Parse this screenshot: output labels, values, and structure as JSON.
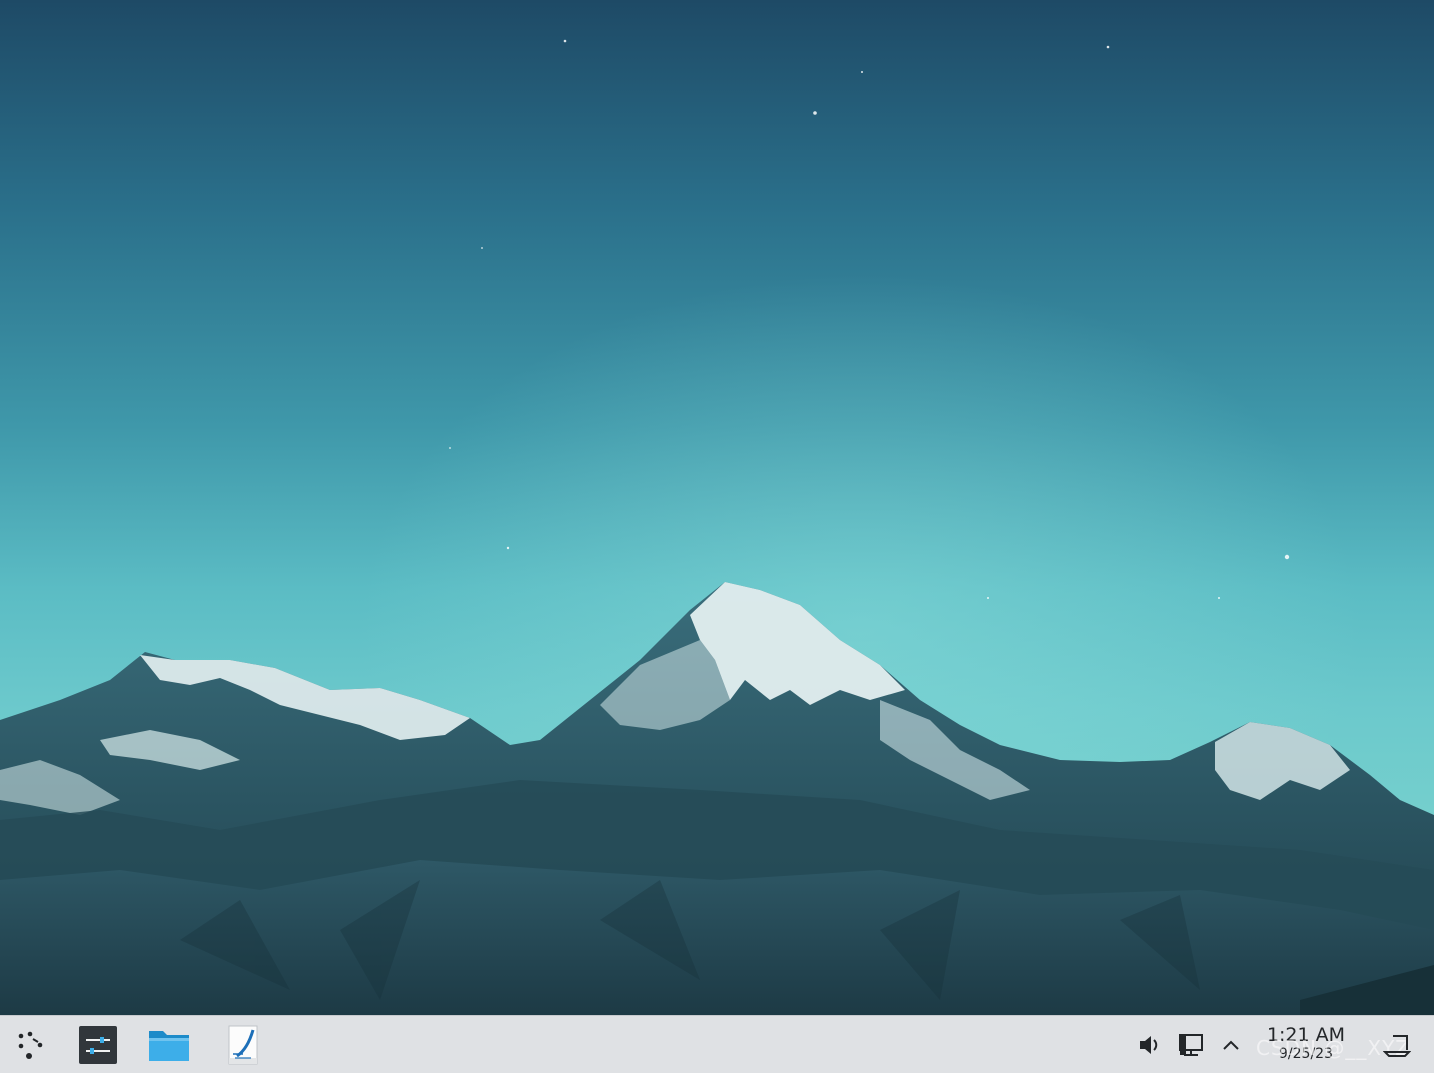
{
  "desktop": {
    "wallpaper": "mountain-landscape-wallpaper"
  },
  "taskbar": {
    "launchers": [
      {
        "name": "application-launcher",
        "icon": "kde-launcher-icon"
      },
      {
        "name": "system-settings",
        "icon": "settings-sliders-icon"
      },
      {
        "name": "file-manager",
        "icon": "folder-icon"
      },
      {
        "name": "text-editor",
        "icon": "text-editor-pen-icon"
      }
    ],
    "tray": {
      "icons": [
        "speaker-icon",
        "network-icon",
        "chevron-up-icon",
        "show-desktop-icon"
      ]
    },
    "clock": {
      "time": "1:21 AM",
      "date": "9/25/23"
    },
    "watermark": "CSDN @__XYZ"
  },
  "colors": {
    "taskbar_bg": "#dfe1e4",
    "folder_blue": "#3daee9",
    "settings_dark": "#31363b"
  }
}
